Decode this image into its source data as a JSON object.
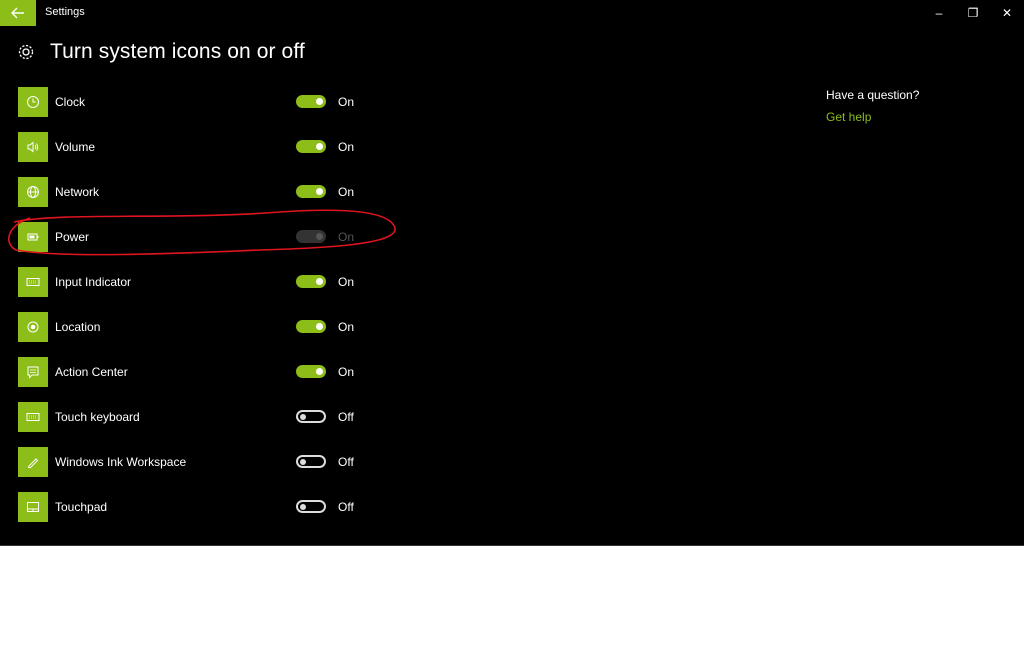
{
  "window": {
    "title": "Settings",
    "controls": {
      "minimize": "–",
      "restore": "❐",
      "close": "✕"
    }
  },
  "page": {
    "title": "Turn system icons on or off"
  },
  "items": [
    {
      "label": "Clock",
      "state": "On",
      "status": "on",
      "icon": "clock-icon"
    },
    {
      "label": "Volume",
      "state": "On",
      "status": "on",
      "icon": "volume-icon"
    },
    {
      "label": "Network",
      "state": "On",
      "status": "on",
      "icon": "network-icon"
    },
    {
      "label": "Power",
      "state": "On",
      "status": "disabled",
      "icon": "battery-icon"
    },
    {
      "label": "Input Indicator",
      "state": "On",
      "status": "on",
      "icon": "keyboard-icon"
    },
    {
      "label": "Location",
      "state": "On",
      "status": "on",
      "icon": "location-icon"
    },
    {
      "label": "Action Center",
      "state": "On",
      "status": "on",
      "icon": "action-center-icon"
    },
    {
      "label": "Touch keyboard",
      "state": "Off",
      "status": "off",
      "icon": "keyboard-icon"
    },
    {
      "label": "Windows Ink Workspace",
      "state": "Off",
      "status": "off",
      "icon": "pen-icon"
    },
    {
      "label": "Touchpad",
      "state": "Off",
      "status": "off",
      "icon": "touchpad-icon"
    }
  ],
  "sidebar": {
    "question": "Have a question?",
    "help_link": "Get help"
  },
  "colors": {
    "accent": "#8cbd18",
    "annotation": "#e0141e",
    "background": "#000000"
  }
}
